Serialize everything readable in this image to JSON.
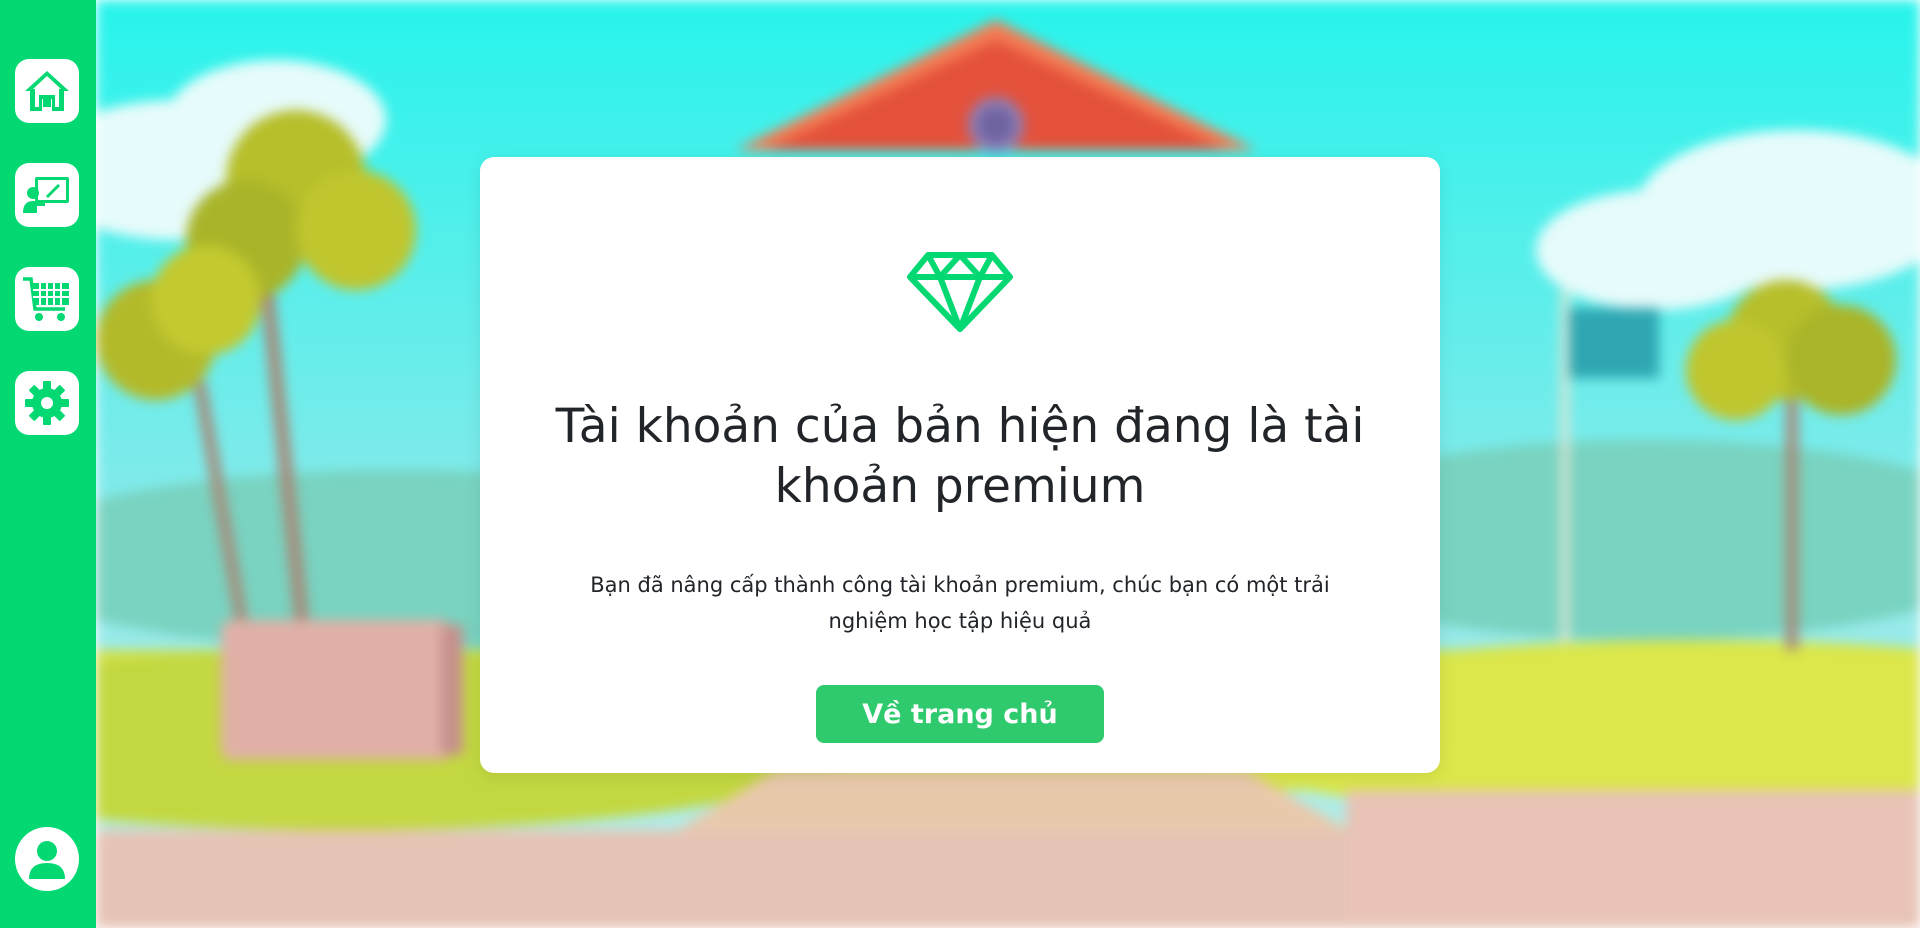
{
  "sidebar": {
    "items": [
      {
        "icon": "home-icon"
      },
      {
        "icon": "classroom-icon"
      },
      {
        "icon": "shop-cart-icon"
      },
      {
        "icon": "gear-icon"
      }
    ],
    "profile_icon": "user-icon",
    "accent_color": "#03d872"
  },
  "modal": {
    "icon": "diamond-icon",
    "title": "Tài khoản của bản hiện đang là tài khoản premium",
    "description": "Bạn đã nâng cấp thành công tài khoản premium, chúc bạn có một trải nghiệm học tập hiệu quả",
    "button_label": "Về trang chủ",
    "button_color": "#2fc96e"
  }
}
